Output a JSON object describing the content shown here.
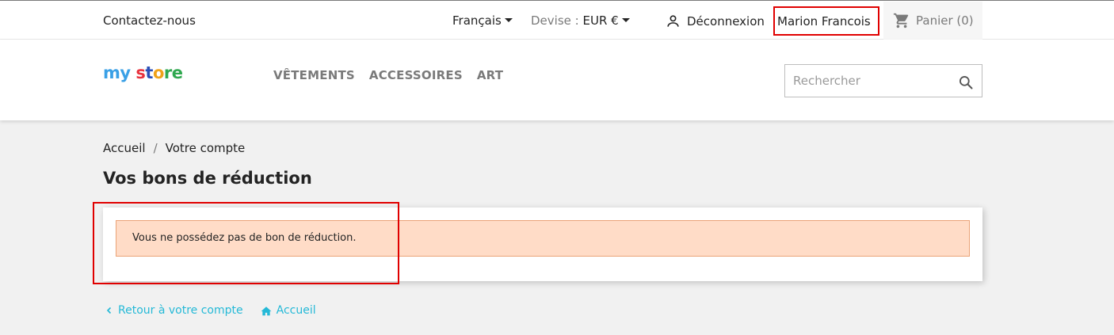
{
  "topbar": {
    "contact": "Contactez-nous",
    "language": "Français",
    "currency_label": "Devise :",
    "currency_value": "EUR €",
    "logout": "Déconnexion",
    "account_name": "Marion Francois",
    "cart": "Panier (0)"
  },
  "header": {
    "logo": {
      "part1": "my",
      "part2": "s",
      "part3": "t",
      "part4": "o",
      "part5": "re"
    },
    "menu": [
      "Vêtements",
      "Accessoires",
      "Art"
    ],
    "search_placeholder": "Rechercher"
  },
  "breadcrumb": [
    "Accueil",
    "Votre compte"
  ],
  "page_title": "Vos bons de réduction",
  "alert_text": "Vous ne possédez pas de bon de réduction.",
  "footer_links": {
    "back": "Retour à votre compte",
    "home": "Accueil"
  },
  "colors": {
    "link": "#24b9d7",
    "alert_bg": "#ffdcc7",
    "alert_border": "#eba377",
    "highlight": "#e00000"
  },
  "icons": [
    "person-icon",
    "cart-icon",
    "search-icon",
    "chevron-left-icon",
    "home-icon"
  ]
}
